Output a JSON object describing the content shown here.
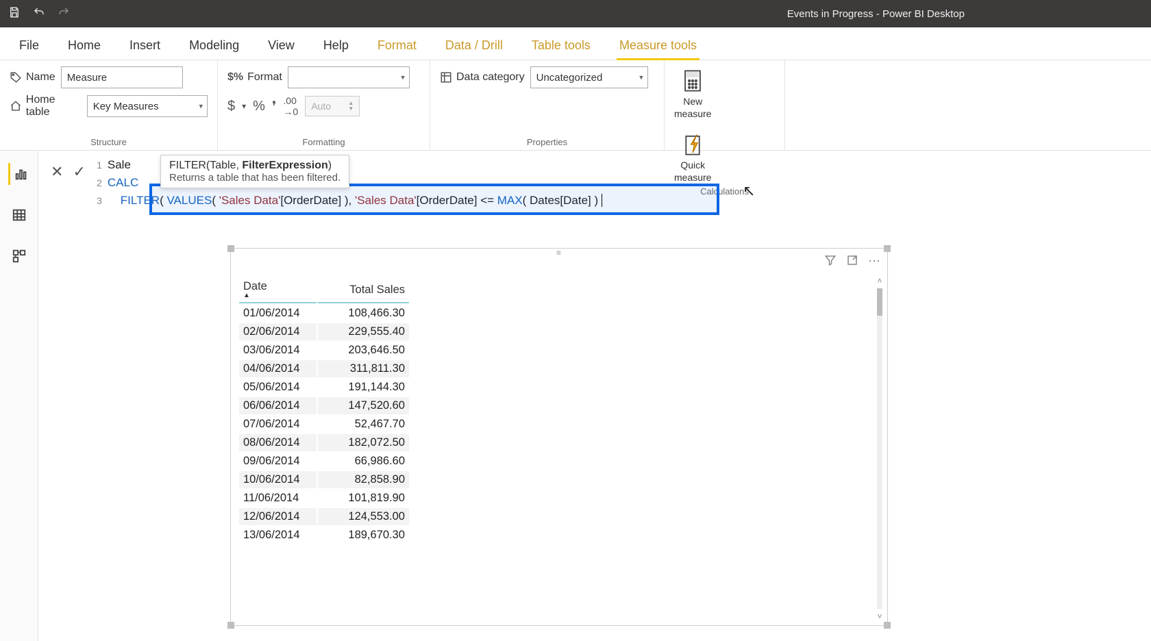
{
  "titlebar": {
    "title": "Events in Progress - Power BI Desktop"
  },
  "ribbon": {
    "tabs": [
      "File",
      "Home",
      "Insert",
      "Modeling",
      "View",
      "Help",
      "Format",
      "Data / Drill",
      "Table tools",
      "Measure tools"
    ],
    "active_tab": "Measure tools",
    "accent_tabs": [
      "Format",
      "Data / Drill",
      "Table tools",
      "Measure tools"
    ],
    "groups": {
      "structure": {
        "label": "Structure",
        "name_label": "Name",
        "name_value": "Measure",
        "home_table_label": "Home table",
        "home_table_value": "Key Measures"
      },
      "formatting": {
        "label": "Formatting",
        "format_label": "Format",
        "format_value": "",
        "auto_placeholder": "Auto"
      },
      "properties": {
        "label": "Properties",
        "data_category_label": "Data category",
        "data_category_value": "Uncategorized"
      },
      "calculations": {
        "label": "Calculations",
        "new_measure": "New\nmeasure",
        "quick_measure": "Quick\nmeasure"
      }
    }
  },
  "formula": {
    "lines": {
      "1": {
        "gutter": "1",
        "prefix": "Sale"
      },
      "2": {
        "gutter": "2",
        "prefix": "CALC"
      },
      "3": {
        "gutter": "3",
        "kw_filter": "FILTER",
        "p1": "( ",
        "kw_values": "VALUES",
        "p2": "( ",
        "str1": "'Sales Data'",
        "col1": "[OrderDate] ), ",
        "str2": "'Sales Data'",
        "col2": "[OrderDate] <= ",
        "kw_max": "MAX",
        "p3": "( Dates[Date] )"
      }
    },
    "tooltip": {
      "sig_plain": "FILTER(Table, ",
      "sig_bold": "FilterExpression",
      "sig_tail": ")",
      "desc": "Returns a table that has been filtered."
    }
  },
  "table": {
    "headers": [
      "Date",
      "Total Sales"
    ],
    "rows": [
      [
        "01/06/2014",
        "108,466.30"
      ],
      [
        "02/06/2014",
        "229,555.40"
      ],
      [
        "03/06/2014",
        "203,646.50"
      ],
      [
        "04/06/2014",
        "311,811.30"
      ],
      [
        "05/06/2014",
        "191,144.30"
      ],
      [
        "06/06/2014",
        "147,520.60"
      ],
      [
        "07/06/2014",
        "52,467.70"
      ],
      [
        "08/06/2014",
        "182,072.50"
      ],
      [
        "09/06/2014",
        "66,986.60"
      ],
      [
        "10/06/2014",
        "82,858.90"
      ],
      [
        "11/06/2014",
        "101,819.90"
      ],
      [
        "12/06/2014",
        "124,553.00"
      ],
      [
        "13/06/2014",
        "189,670.30"
      ]
    ]
  }
}
